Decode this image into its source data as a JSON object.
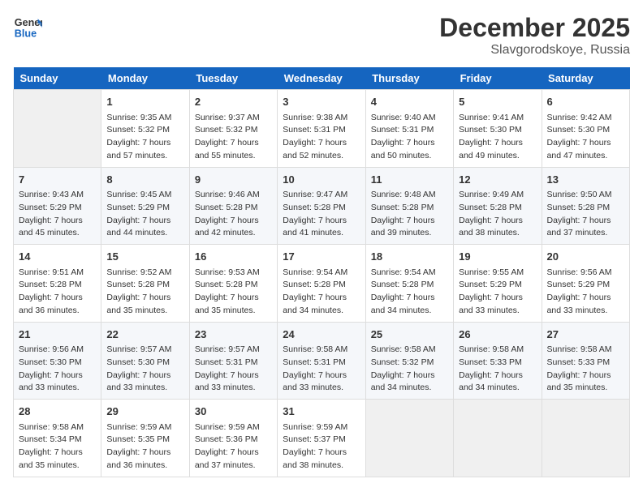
{
  "logo": {
    "line1": "General",
    "line2": "Blue"
  },
  "title": "December 2025",
  "location": "Slavgorodskoye, Russia",
  "weekdays": [
    "Sunday",
    "Monday",
    "Tuesday",
    "Wednesday",
    "Thursday",
    "Friday",
    "Saturday"
  ],
  "weeks": [
    [
      {
        "day": "",
        "empty": true
      },
      {
        "day": "1",
        "sunrise": "Sunrise: 9:35 AM",
        "sunset": "Sunset: 5:32 PM",
        "daylight": "Daylight: 7 hours and 57 minutes."
      },
      {
        "day": "2",
        "sunrise": "Sunrise: 9:37 AM",
        "sunset": "Sunset: 5:32 PM",
        "daylight": "Daylight: 7 hours and 55 minutes."
      },
      {
        "day": "3",
        "sunrise": "Sunrise: 9:38 AM",
        "sunset": "Sunset: 5:31 PM",
        "daylight": "Daylight: 7 hours and 52 minutes."
      },
      {
        "day": "4",
        "sunrise": "Sunrise: 9:40 AM",
        "sunset": "Sunset: 5:31 PM",
        "daylight": "Daylight: 7 hours and 50 minutes."
      },
      {
        "day": "5",
        "sunrise": "Sunrise: 9:41 AM",
        "sunset": "Sunset: 5:30 PM",
        "daylight": "Daylight: 7 hours and 49 minutes."
      },
      {
        "day": "6",
        "sunrise": "Sunrise: 9:42 AM",
        "sunset": "Sunset: 5:30 PM",
        "daylight": "Daylight: 7 hours and 47 minutes."
      }
    ],
    [
      {
        "day": "7",
        "sunrise": "Sunrise: 9:43 AM",
        "sunset": "Sunset: 5:29 PM",
        "daylight": "Daylight: 7 hours and 45 minutes."
      },
      {
        "day": "8",
        "sunrise": "Sunrise: 9:45 AM",
        "sunset": "Sunset: 5:29 PM",
        "daylight": "Daylight: 7 hours and 44 minutes."
      },
      {
        "day": "9",
        "sunrise": "Sunrise: 9:46 AM",
        "sunset": "Sunset: 5:28 PM",
        "daylight": "Daylight: 7 hours and 42 minutes."
      },
      {
        "day": "10",
        "sunrise": "Sunrise: 9:47 AM",
        "sunset": "Sunset: 5:28 PM",
        "daylight": "Daylight: 7 hours and 41 minutes."
      },
      {
        "day": "11",
        "sunrise": "Sunrise: 9:48 AM",
        "sunset": "Sunset: 5:28 PM",
        "daylight": "Daylight: 7 hours and 39 minutes."
      },
      {
        "day": "12",
        "sunrise": "Sunrise: 9:49 AM",
        "sunset": "Sunset: 5:28 PM",
        "daylight": "Daylight: 7 hours and 38 minutes."
      },
      {
        "day": "13",
        "sunrise": "Sunrise: 9:50 AM",
        "sunset": "Sunset: 5:28 PM",
        "daylight": "Daylight: 7 hours and 37 minutes."
      }
    ],
    [
      {
        "day": "14",
        "sunrise": "Sunrise: 9:51 AM",
        "sunset": "Sunset: 5:28 PM",
        "daylight": "Daylight: 7 hours and 36 minutes."
      },
      {
        "day": "15",
        "sunrise": "Sunrise: 9:52 AM",
        "sunset": "Sunset: 5:28 PM",
        "daylight": "Daylight: 7 hours and 35 minutes."
      },
      {
        "day": "16",
        "sunrise": "Sunrise: 9:53 AM",
        "sunset": "Sunset: 5:28 PM",
        "daylight": "Daylight: 7 hours and 35 minutes."
      },
      {
        "day": "17",
        "sunrise": "Sunrise: 9:54 AM",
        "sunset": "Sunset: 5:28 PM",
        "daylight": "Daylight: 7 hours and 34 minutes."
      },
      {
        "day": "18",
        "sunrise": "Sunrise: 9:54 AM",
        "sunset": "Sunset: 5:28 PM",
        "daylight": "Daylight: 7 hours and 34 minutes."
      },
      {
        "day": "19",
        "sunrise": "Sunrise: 9:55 AM",
        "sunset": "Sunset: 5:29 PM",
        "daylight": "Daylight: 7 hours and 33 minutes."
      },
      {
        "day": "20",
        "sunrise": "Sunrise: 9:56 AM",
        "sunset": "Sunset: 5:29 PM",
        "daylight": "Daylight: 7 hours and 33 minutes."
      }
    ],
    [
      {
        "day": "21",
        "sunrise": "Sunrise: 9:56 AM",
        "sunset": "Sunset: 5:30 PM",
        "daylight": "Daylight: 7 hours and 33 minutes."
      },
      {
        "day": "22",
        "sunrise": "Sunrise: 9:57 AM",
        "sunset": "Sunset: 5:30 PM",
        "daylight": "Daylight: 7 hours and 33 minutes."
      },
      {
        "day": "23",
        "sunrise": "Sunrise: 9:57 AM",
        "sunset": "Sunset: 5:31 PM",
        "daylight": "Daylight: 7 hours and 33 minutes."
      },
      {
        "day": "24",
        "sunrise": "Sunrise: 9:58 AM",
        "sunset": "Sunset: 5:31 PM",
        "daylight": "Daylight: 7 hours and 33 minutes."
      },
      {
        "day": "25",
        "sunrise": "Sunrise: 9:58 AM",
        "sunset": "Sunset: 5:32 PM",
        "daylight": "Daylight: 7 hours and 34 minutes."
      },
      {
        "day": "26",
        "sunrise": "Sunrise: 9:58 AM",
        "sunset": "Sunset: 5:33 PM",
        "daylight": "Daylight: 7 hours and 34 minutes."
      },
      {
        "day": "27",
        "sunrise": "Sunrise: 9:58 AM",
        "sunset": "Sunset: 5:33 PM",
        "daylight": "Daylight: 7 hours and 35 minutes."
      }
    ],
    [
      {
        "day": "28",
        "sunrise": "Sunrise: 9:58 AM",
        "sunset": "Sunset: 5:34 PM",
        "daylight": "Daylight: 7 hours and 35 minutes."
      },
      {
        "day": "29",
        "sunrise": "Sunrise: 9:59 AM",
        "sunset": "Sunset: 5:35 PM",
        "daylight": "Daylight: 7 hours and 36 minutes."
      },
      {
        "day": "30",
        "sunrise": "Sunrise: 9:59 AM",
        "sunset": "Sunset: 5:36 PM",
        "daylight": "Daylight: 7 hours and 37 minutes."
      },
      {
        "day": "31",
        "sunrise": "Sunrise: 9:59 AM",
        "sunset": "Sunset: 5:37 PM",
        "daylight": "Daylight: 7 hours and 38 minutes."
      },
      {
        "day": "",
        "empty": true
      },
      {
        "day": "",
        "empty": true
      },
      {
        "day": "",
        "empty": true
      }
    ]
  ]
}
